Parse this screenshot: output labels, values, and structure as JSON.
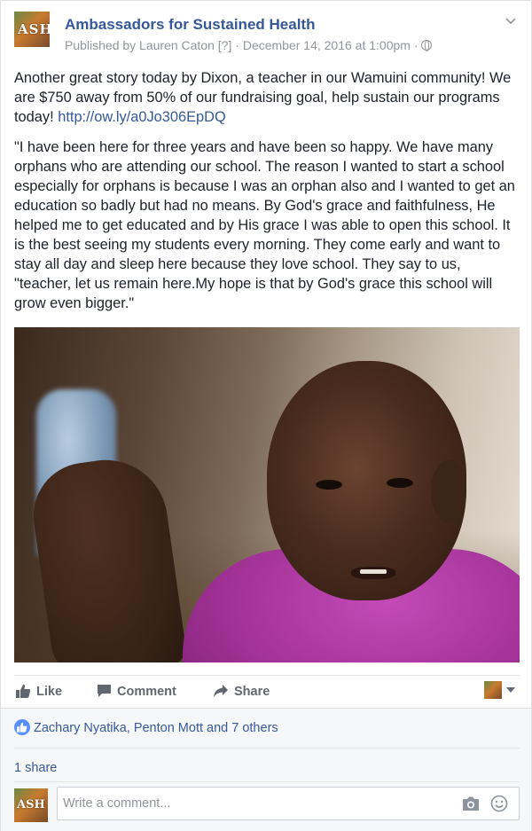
{
  "post": {
    "page_name": "Ambassadors for Sustained Health",
    "avatar_text": "ASH",
    "published_by": "Published by Lauren Caton",
    "help_marker": "[?]",
    "separator": "·",
    "date": "December 14, 2016 at 1:00pm",
    "privacy_icon": "globe-icon",
    "intro": "Another great story today by Dixon, a teacher in our Wamuini community! We are $750 away from 50% of our fundraising goal, help sustain our programs today! ",
    "link": "http://ow.ly/a0Jo306EpDQ",
    "quote": "\"I have been here for three years and have been so happy. We have many orphans who are attending our school. The reason I wanted to start a school especially for orphans is because I was an orphan also and I wanted to get an education so badly but had no means. By God's grace and faithfulness, He helped me to get educated and by His grace I was able to open this school. It is the best seeing my students every morning. They come early and want to stay all day and sleep here because they love school. They say to us, \"teacher, let us remain here.My hope is that by God's grace this school will grow even bigger.\""
  },
  "actions": {
    "like": "Like",
    "comment": "Comment",
    "share": "Share"
  },
  "reactions": {
    "likers_text": "Zachary Nyatika, Penton Mott and 7 others",
    "shares_text": "1 share"
  },
  "composer": {
    "avatar_text": "ASH",
    "placeholder": "Write a comment..."
  },
  "colors": {
    "link": "#365899",
    "muted": "#90949c",
    "like_blue": "#5890ff"
  }
}
